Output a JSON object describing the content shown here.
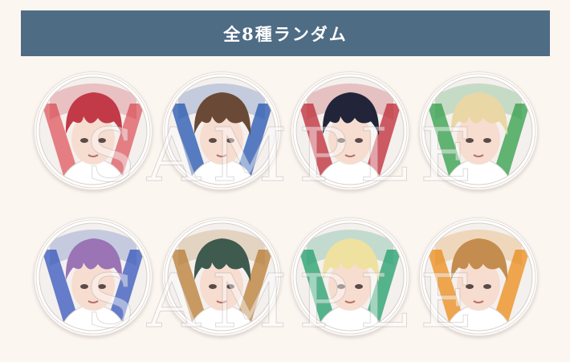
{
  "banner": {
    "title": "全8種ランダム"
  },
  "watermark": {
    "text": "SAMPLE"
  },
  "badges": [
    {
      "hair": "#c23a48",
      "accent": "#c9343f",
      "frame": "#e06a70"
    },
    {
      "hair": "#6a4a36",
      "accent": "#2f5aa8",
      "frame": "#3a66b8"
    },
    {
      "hair": "#22253a",
      "accent": "#b8323d",
      "frame": "#c4404a"
    },
    {
      "hair": "#e9d7a6",
      "accent": "#3a9b4e",
      "frame": "#45a85a"
    },
    {
      "hair": "#9a74b5",
      "accent": "#3d59b5",
      "frame": "#4a67c2"
    },
    {
      "hair": "#3f5a4f",
      "accent": "#b07a3a",
      "frame": "#c08a48"
    },
    {
      "hair": "#efe1a0",
      "accent": "#2f9a6e",
      "frame": "#38a87a"
    },
    {
      "hair": "#c48c4e",
      "accent": "#e08a22",
      "frame": "#ec9830"
    }
  ]
}
